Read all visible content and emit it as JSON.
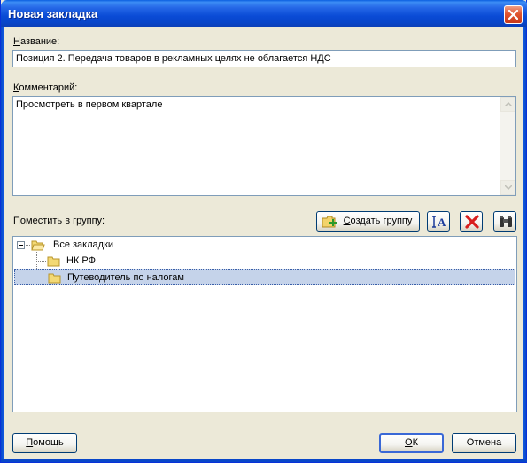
{
  "window": {
    "title": "Новая закладка"
  },
  "name_field": {
    "label_first": "Н",
    "label_rest": "азвание:",
    "value": "Позиция 2. Передача товаров в рекламных целях не облагается НДС"
  },
  "comment_field": {
    "label_first": "К",
    "label_rest": "омментарий:",
    "value": "Просмотреть в первом квартале"
  },
  "group": {
    "label": "Поместить в группу:",
    "create_button_first": "С",
    "create_button_rest": "оздать группу",
    "tree": [
      {
        "label": "Все закладки",
        "level": 0,
        "expanded": true,
        "selected": false
      },
      {
        "label": "НК РФ",
        "level": 1,
        "selected": false
      },
      {
        "label": "Путеводитель по налогам",
        "level": 1,
        "selected": true
      }
    ]
  },
  "footer": {
    "help_first": "П",
    "help_rest": "омощь",
    "ok_first": "О",
    "ok_rest": "К",
    "cancel_label": "Отмена"
  },
  "colors": {
    "title_bar": "#0a4bd6",
    "selection": "#c5d3ea",
    "dialog_bg": "#ece9d8"
  }
}
